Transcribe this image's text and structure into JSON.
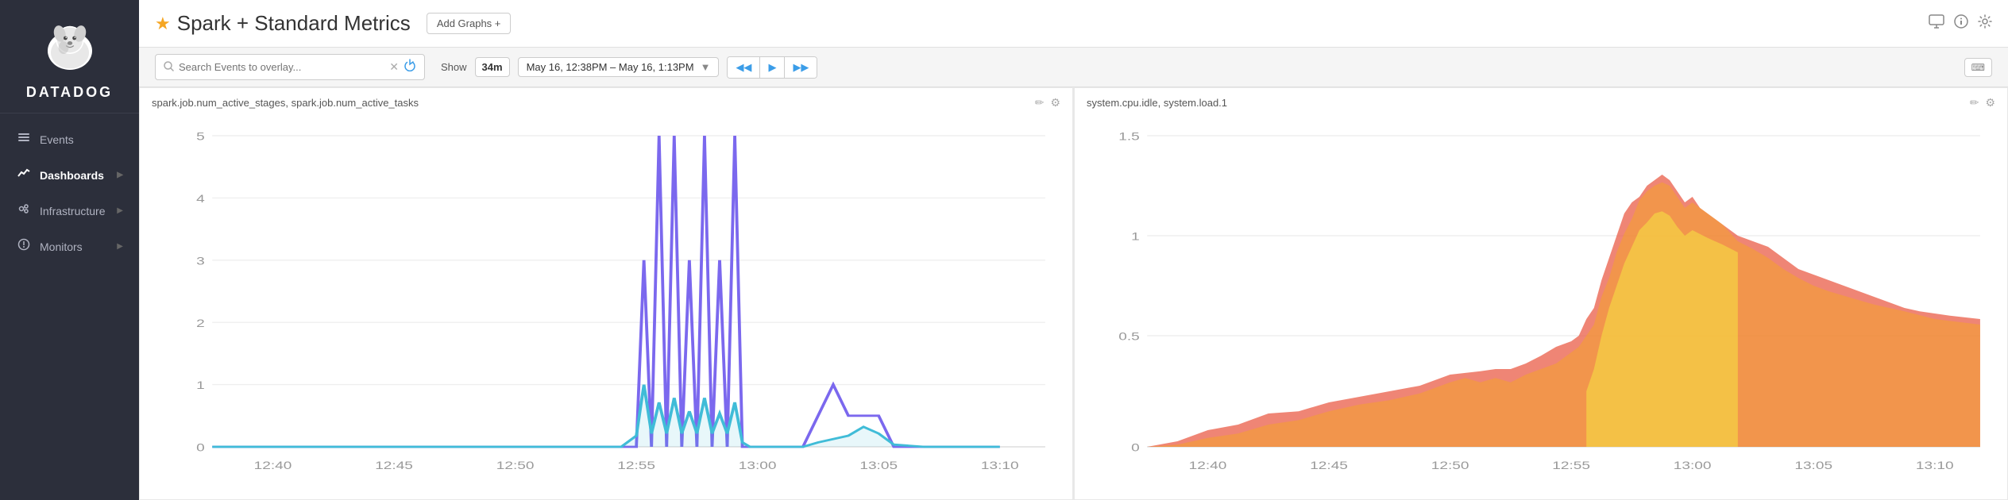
{
  "sidebar": {
    "brand": "DATADOG",
    "items": [
      {
        "id": "events",
        "label": "Events",
        "icon": "☰",
        "hasChevron": false
      },
      {
        "id": "dashboards",
        "label": "Dashboards",
        "icon": "📊",
        "hasChevron": true,
        "active": true
      },
      {
        "id": "infrastructure",
        "label": "Infrastructure",
        "icon": "⚙",
        "hasChevron": true
      },
      {
        "id": "monitors",
        "label": "Monitors",
        "icon": "ℹ",
        "hasChevron": true
      }
    ]
  },
  "topbar": {
    "title": "Spark + Standard Metrics",
    "add_graphs_label": "Add Graphs +",
    "icons": {
      "monitor": "🖥",
      "info": "ℹ",
      "settings": "⚙"
    }
  },
  "toolbar": {
    "search_placeholder": "Search Events to overlay...",
    "show_label": "Show",
    "time_duration": "34m",
    "time_range": "May 16, 12:38PM – May 16, 1:13PM",
    "keyboard_label": "⌨"
  },
  "charts": [
    {
      "id": "chart1",
      "title": "spark.job.num_active_stages, spark.job.num_active_tasks",
      "y_max": 5,
      "y_labels": [
        "5",
        "4",
        "3",
        "2",
        "1",
        "0"
      ],
      "x_labels": [
        "12:40",
        "12:45",
        "12:50",
        "12:55",
        "13:00",
        "13:05",
        "13:10"
      ]
    },
    {
      "id": "chart2",
      "title": "system.cpu.idle, system.load.1",
      "y_max": 1.5,
      "y_labels": [
        "1.5",
        "1",
        "0.5",
        "0"
      ],
      "x_labels": [
        "12:40",
        "12:45",
        "12:50",
        "12:55",
        "13:00",
        "13:05",
        "13:10"
      ]
    }
  ]
}
